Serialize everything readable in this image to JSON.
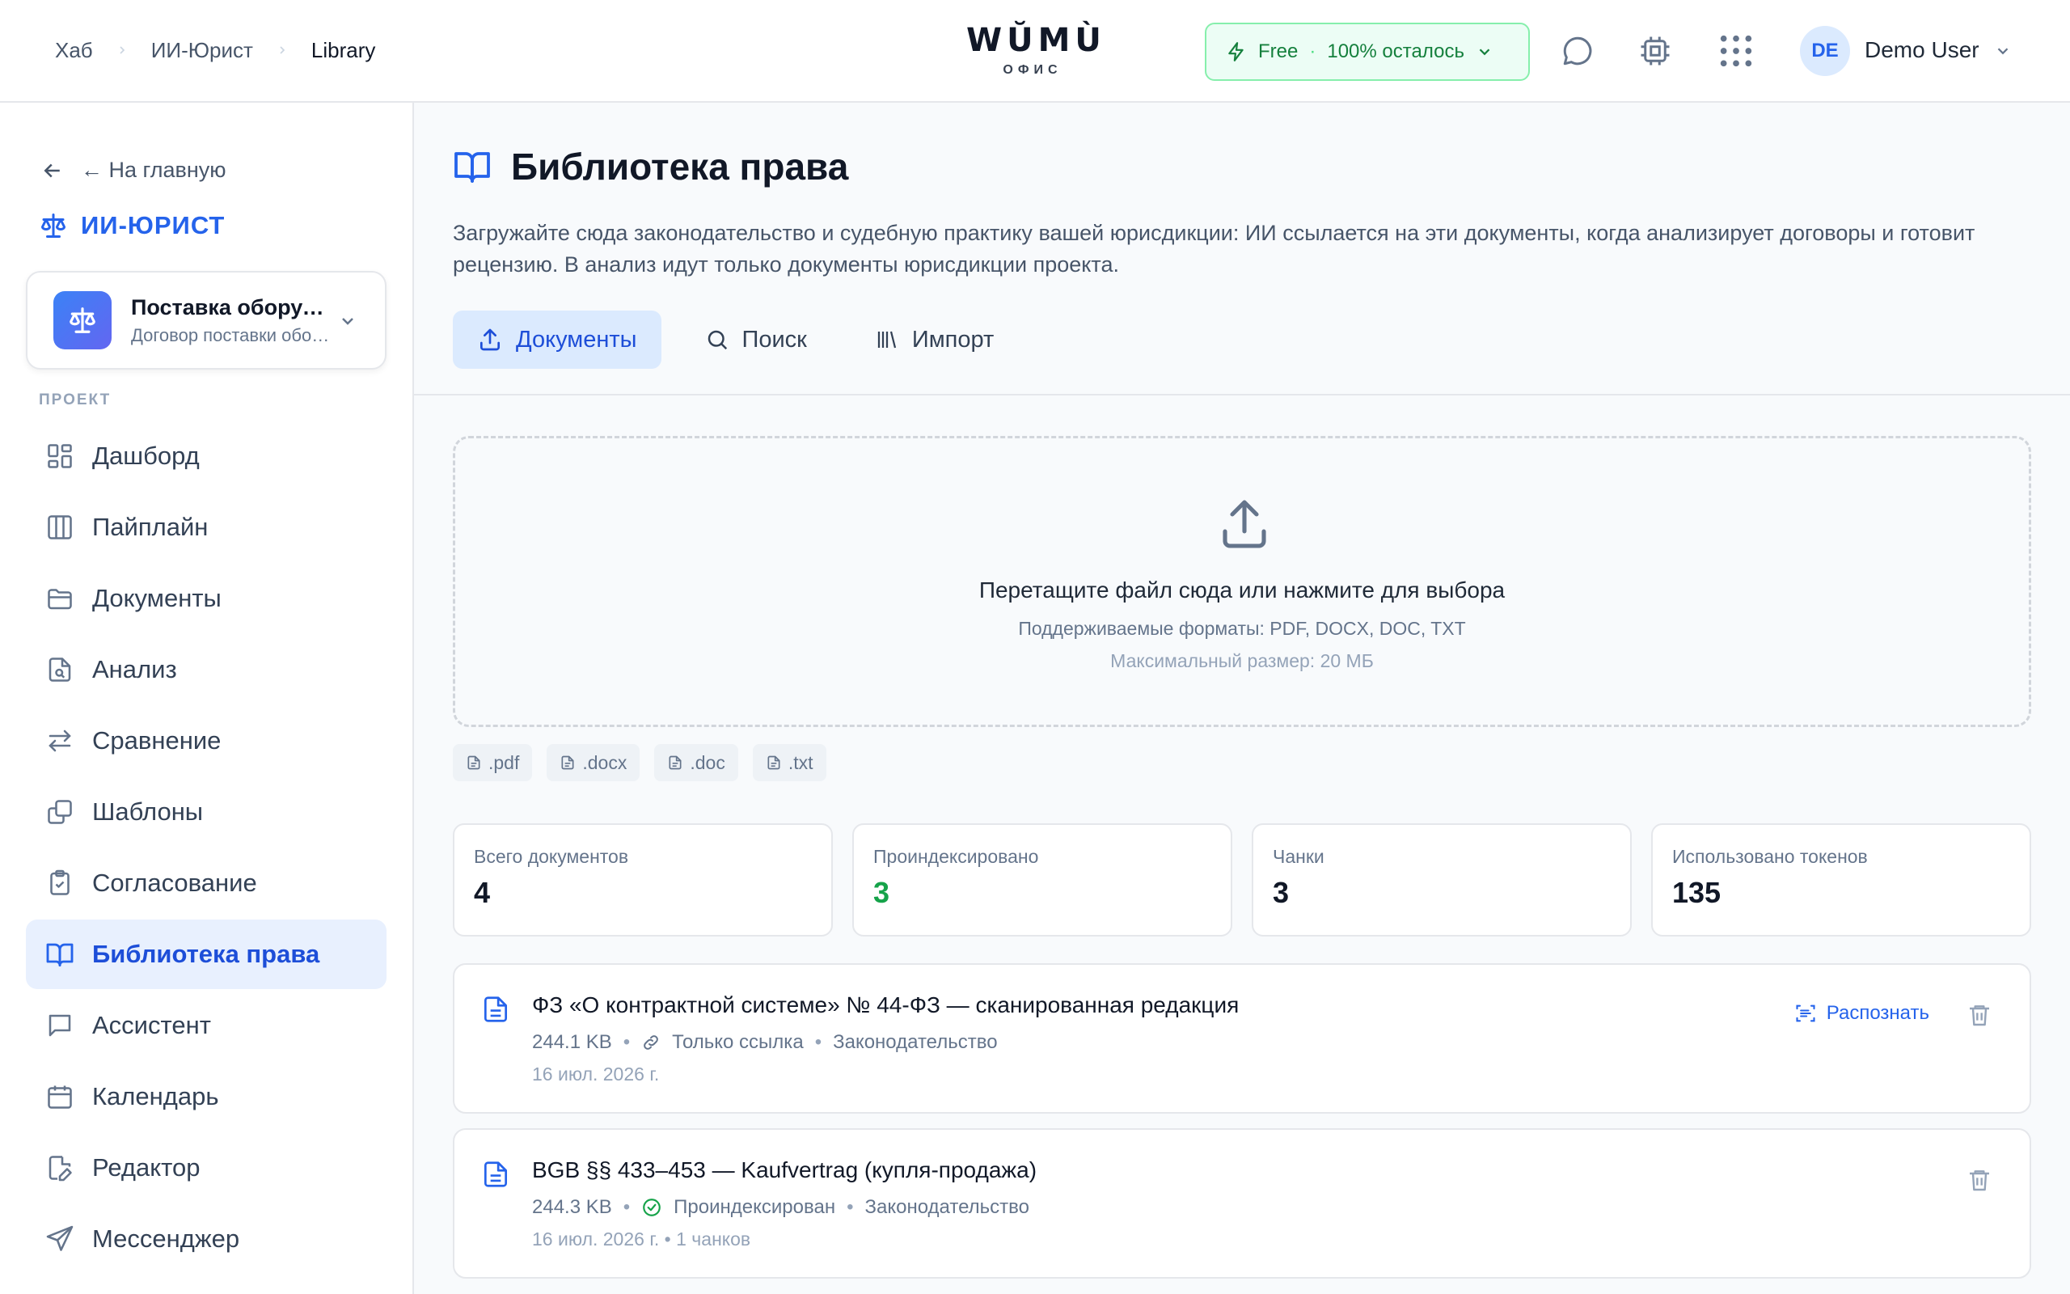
{
  "header": {
    "breadcrumbs": [
      "Хаб",
      "ИИ-Юрист",
      "Library"
    ],
    "logo": "WŬMÙ",
    "logo_sub": "ОФИС",
    "plan_name": "Free",
    "plan_dot": "·",
    "plan_remaining": "100% осталось",
    "user_initials": "DE",
    "user_name": "Demo User"
  },
  "sidebar": {
    "back_label": "← На главную",
    "brand": "ИИ-ЮРИСТ",
    "project_name": "Поставка оборудования",
    "project_sub": "Договор поставки оборудования",
    "section_label": "ПРОЕКТ",
    "items": [
      {
        "label": "Дашборд",
        "icon": "dashboard-icon"
      },
      {
        "label": "Пайплайн",
        "icon": "columns-icon"
      },
      {
        "label": "Документы",
        "icon": "folder-icon"
      },
      {
        "label": "Анализ",
        "icon": "file-search-icon"
      },
      {
        "label": "Сравнение",
        "icon": "arrows-swap-icon"
      },
      {
        "label": "Шаблоны",
        "icon": "copy-icon"
      },
      {
        "label": "Согласование",
        "icon": "clipboard-check-icon"
      },
      {
        "label": "Библиотека права",
        "icon": "book-icon",
        "active": true
      },
      {
        "label": "Ассистент",
        "icon": "chat-icon"
      },
      {
        "label": "Календарь",
        "icon": "calendar-icon"
      },
      {
        "label": "Редактор",
        "icon": "edit-file-icon"
      },
      {
        "label": "Мессенджер",
        "icon": "send-icon"
      }
    ]
  },
  "main": {
    "title": "Библиотека права",
    "description": "Загружайте сюда законодательство и судебную практику вашей юрисдикции: ИИ ссылается на эти документы, когда анализирует договоры и готовит рецензию. В анализ идут только документы юрисдикции проекта.",
    "tabs": [
      {
        "label": "Документы",
        "active": true
      },
      {
        "label": "Поиск"
      },
      {
        "label": "Импорт"
      }
    ],
    "drop": {
      "title": "Перетащите файл сюда или нажмите для выбора",
      "formats": "Поддерживаемые форматы: PDF, DOCX, DOC, TXT",
      "max_size": "Максимальный размер: 20 МБ"
    },
    "chips": [
      ".pdf",
      ".docx",
      ".doc",
      ".txt"
    ],
    "stats": [
      {
        "label": "Всего документов",
        "value": "4"
      },
      {
        "label": "Проиндексировано",
        "value": "3"
      },
      {
        "label": "Чанки",
        "value": "3"
      },
      {
        "label": "Использовано токенов",
        "value": "135"
      }
    ],
    "docs": [
      {
        "title": "ФЗ «О контрактной системе» № 44-ФЗ — сканированная редакция",
        "size": "244.1 KB",
        "status": "Только ссылка",
        "category": "Законодательство",
        "date": "16 июл. 2026 г.",
        "action": "Распознать"
      },
      {
        "title": "BGB §§ 433–453 — Kaufvertrag (купля-продажа)",
        "size": "244.3 KB",
        "status": "Проиндексирован",
        "category": "Законодательство",
        "date": "16 июл. 2026 г. • 1 чанков"
      }
    ]
  },
  "colors": {
    "accent": "#2563eb",
    "success": "#16a34a",
    "plan_bg": "#ecfdf5"
  }
}
